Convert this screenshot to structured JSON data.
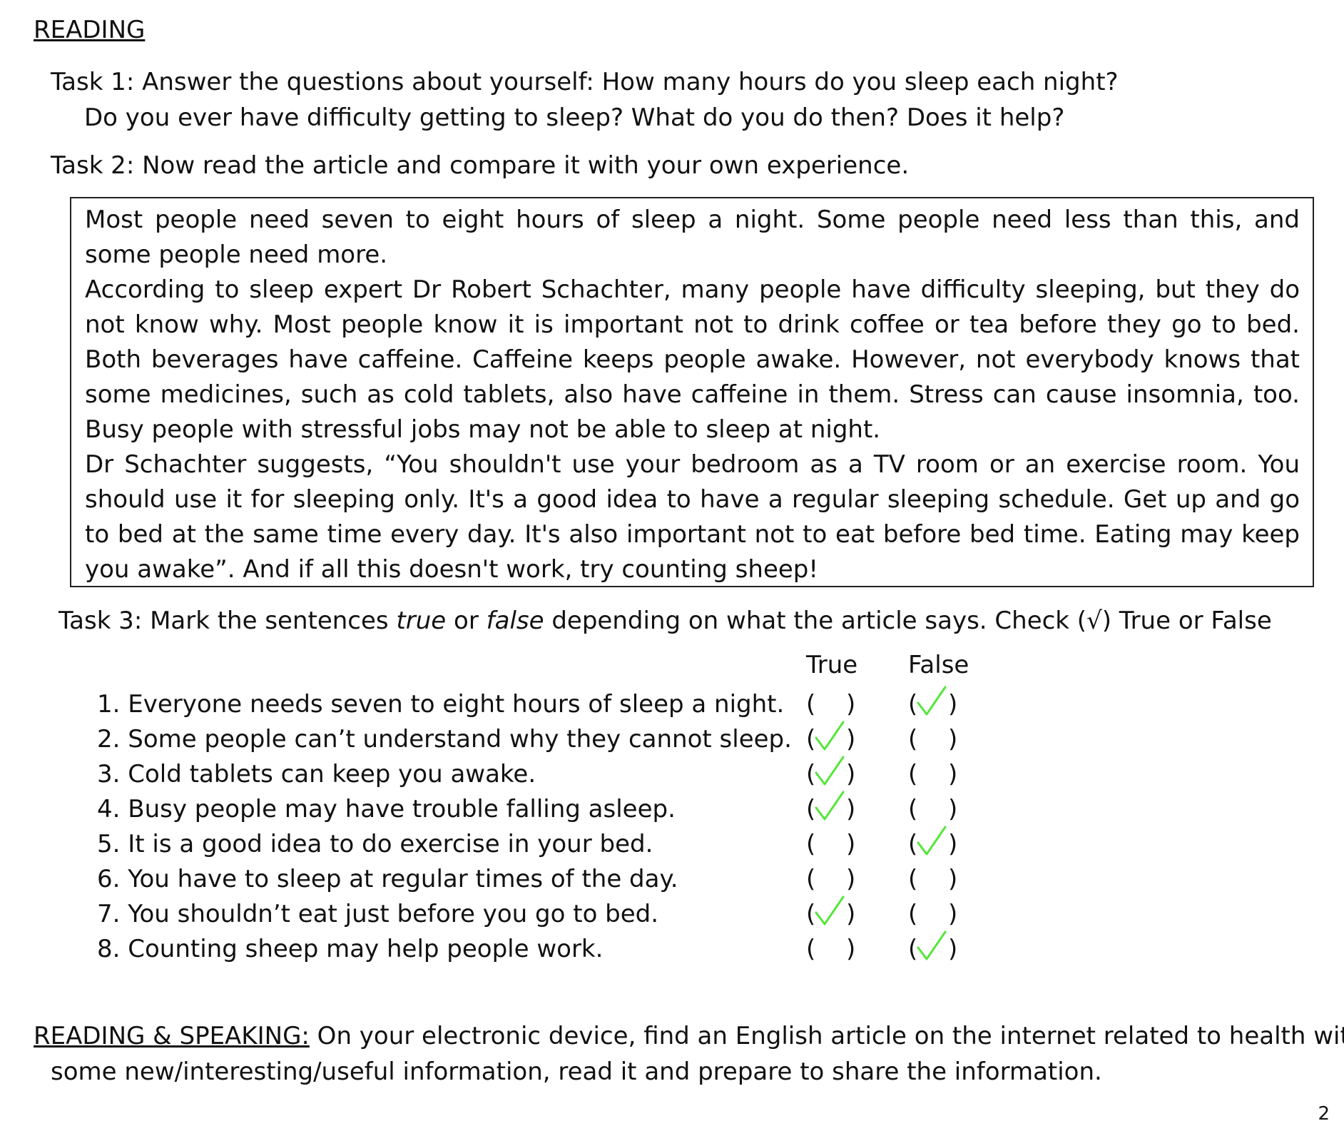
{
  "heading": "READING",
  "task1": {
    "line1": "Task 1: Answer the questions about yourself: How many hours do you sleep each night?",
    "line2": "Do you ever have difficulty getting to sleep? What do you do then? Does it help?"
  },
  "task2": "Task 2: Now read the article and compare it with your own experience.",
  "article": {
    "p1": "Most people need seven to eight hours of sleep a night. Some people need less than this, and some people need more.",
    "p2": "According to sleep expert Dr Robert Schachter, many people have difficulty sleeping, but they do not know why. Most people know it is important not to drink coffee or tea before they go to bed. Both beverages have caffeine. Caffeine keeps people awake. However, not everybody knows that some medicines, such as cold tablets, also have caffeine in them. Stress can cause insomnia, too. Busy people with stressful jobs may not be able to sleep at night.",
    "p3": "Dr Schachter suggests, “You shouldn't use your bedroom as a TV room or an exercise room. You should use it for sleeping only. It's a good idea to have a regular sleeping schedule. Get up and go to bed at the same time every day. It's also important not to eat before bed time. Eating may keep you awake”. And if all this doesn't work, try counting sheep!"
  },
  "task3": {
    "prefix": "Task 3: Mark the sentences ",
    "true_word": "true",
    "or": " or ",
    "false_word": "false",
    "suffix": " depending on what the article says. Check (√) True or False"
  },
  "columns": {
    "true": "True",
    "false": "False"
  },
  "paren_open": "(",
  "paren_close": ")",
  "questions": [
    {
      "text": "1. Everyone needs seven to eight hours of sleep a night.",
      "checked": "false"
    },
    {
      "text": "2. Some people can’t understand why they cannot sleep.",
      "checked": "true"
    },
    {
      "text": "3. Cold tablets can keep you awake.",
      "checked": "true"
    },
    {
      "text": "4. Busy people may have trouble falling asleep.",
      "checked": "true"
    },
    {
      "text": "5. It is a good idea to do exercise in your bed.",
      "checked": "false"
    },
    {
      "text": "6. You have to sleep at regular times of the day.",
      "checked": "none"
    },
    {
      "text": "7. You shouldn’t eat just before you go to bed.",
      "checked": "true"
    },
    {
      "text": "8. Counting sheep may help people work.",
      "checked": "false"
    }
  ],
  "reading_speaking": {
    "head": "READING & SPEAKING:",
    "line1": " On your electronic device, find an English article on the internet related to health with",
    "line2": "some new/interesting/useful information, read it and prepare to share the information."
  },
  "page_number": "2",
  "mark_color": "#55e63a"
}
